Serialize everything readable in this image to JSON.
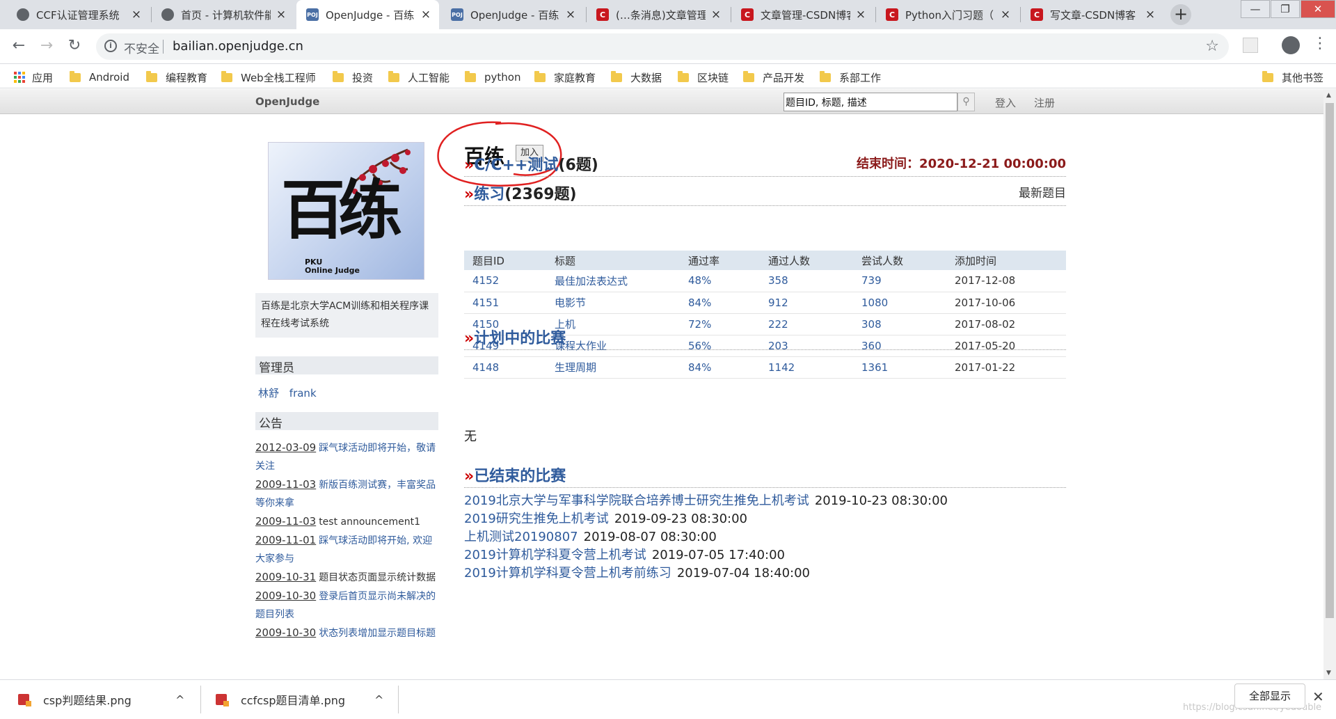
{
  "browser": {
    "tabs": [
      {
        "title": "CCF认证管理系统",
        "icon": "globe-icon",
        "active": false
      },
      {
        "title": "首页 - 计算机软件能",
        "icon": "globe-icon",
        "active": false
      },
      {
        "title": "OpenJudge - 百练",
        "icon": "poj-icon",
        "active": true
      },
      {
        "title": "OpenJudge - 百练",
        "icon": "poj-icon",
        "active": false
      },
      {
        "title": "(…条消息)文章管理",
        "icon": "csdn-icon",
        "active": false
      },
      {
        "title": "文章管理-CSDN博客",
        "icon": "csdn-icon",
        "active": false
      },
      {
        "title": "Python入门习题（",
        "icon": "csdn-icon",
        "active": false
      },
      {
        "title": "写文章-CSDN博客",
        "icon": "csdn-icon",
        "active": false
      }
    ],
    "favicon_poj": "POJ",
    "favicon_csdn": "C",
    "new_tab": "+",
    "close_glyph": "×",
    "window_buttons": [
      "—",
      "❐",
      "✕"
    ],
    "nav": {
      "back": "←",
      "forward": "→",
      "reload": "↻"
    },
    "security_label": "不安全",
    "url": "bailian.openjudge.cn",
    "bookmark_star": "☆",
    "bookmarks": [
      "应用",
      "Android",
      "编程教育",
      "Web全栈工程师",
      "投资",
      "人工智能",
      "python",
      "家庭教育",
      "大数据",
      "区块链",
      "产品开发",
      "系部工作"
    ],
    "other_bookmarks": "其他书签",
    "colors": {
      "tab_strip": "#dee1e6",
      "link": "#2f5b9c",
      "accent_red": "#cc0000"
    }
  },
  "site": {
    "brand": "OpenJudge",
    "search_placeholder": "题目ID, 标题, 描述",
    "login": "登入",
    "register": "注册"
  },
  "sidebar": {
    "logo_alt": "百练 PKU Online Judge",
    "logo_text_top": "PKU",
    "logo_text_bottom": "Online Judge",
    "logo_chars": "百练",
    "intro": "百练是北京大学ACM训练和相关程序课程在线考试系统",
    "admin_heading": "管理员",
    "admins": [
      "林舒",
      "frank"
    ],
    "notice_heading": "公告",
    "notices": [
      {
        "date": "2012-03-09",
        "title": "踩气球活动即将开始，敬请关注",
        "linked": true
      },
      {
        "date": "2009-11-03",
        "title": "新版百练测试赛，丰富奖品等你来拿",
        "linked": true
      },
      {
        "date": "2009-11-03",
        "title": "test announcement1",
        "linked": false
      },
      {
        "date": "2009-11-01",
        "title": "踩气球活动即将开始, 欢迎大家参与",
        "linked": true
      },
      {
        "date": "2009-10-31",
        "title": "题目状态页面显示统计数据",
        "linked": false
      },
      {
        "date": "2009-10-30",
        "title": "登录后首页显示尚未解决的题目列表",
        "linked": true
      },
      {
        "date": "2009-10-30",
        "title": "状态列表增加显示题目标题",
        "linked": true
      }
    ]
  },
  "main": {
    "group_title": "百练",
    "join_label": "加入",
    "raquo": "»",
    "contest": {
      "name": "C/C++测试",
      "count": "(6题)",
      "end_label": "结束时间：2020-12-21 00:00:00"
    },
    "practice": {
      "name": "练习",
      "count": "(2369题)",
      "latest": "最新题目"
    },
    "table_headers": [
      "题目ID",
      "标题",
      "通过率",
      "通过人数",
      "尝试人数",
      "添加时间"
    ],
    "problems": [
      [
        "4152",
        "最佳加法表达式",
        "48%",
        "358",
        "739",
        "2017-12-08"
      ],
      [
        "4151",
        "电影节",
        "84%",
        "912",
        "1080",
        "2017-10-06"
      ],
      [
        "4150",
        "上机",
        "72%",
        "222",
        "308",
        "2017-08-02"
      ],
      [
        "4149",
        "课程大作业",
        "56%",
        "203",
        "360",
        "2017-05-20"
      ],
      [
        "4148",
        "生理周期",
        "84%",
        "1142",
        "1361",
        "2017-01-22"
      ]
    ],
    "planned_heading": "计划中的比赛",
    "planned_none": "无",
    "finished_heading": "已结束的比赛",
    "finished": [
      {
        "name": "2019北京大学与军事科学院联合培养博士研究生推免上机考试",
        "time": "2019-10-23 08:30:00"
      },
      {
        "name": "2019研究生推免上机考试",
        "time": "2019-09-23 08:30:00"
      },
      {
        "name": "上机测试20190807",
        "time": "2019-08-07 08:30:00"
      },
      {
        "name": "2019计算机学科夏令营上机考试",
        "time": "2019-07-05 17:40:00"
      },
      {
        "name": "2019计算机学科夏令营上机考前练习",
        "time": "2019-07-04 18:40:00"
      }
    ]
  },
  "downloads": {
    "items": [
      "csp判题结果.png",
      "ccfcsp题目清单.png"
    ],
    "expand_glyph": "^",
    "show_all": "全部显示",
    "close": "✕",
    "watermark": "https://blog.csdn.net/yedouble"
  },
  "scrollbar": {
    "up": "▲",
    "down": "▼"
  }
}
